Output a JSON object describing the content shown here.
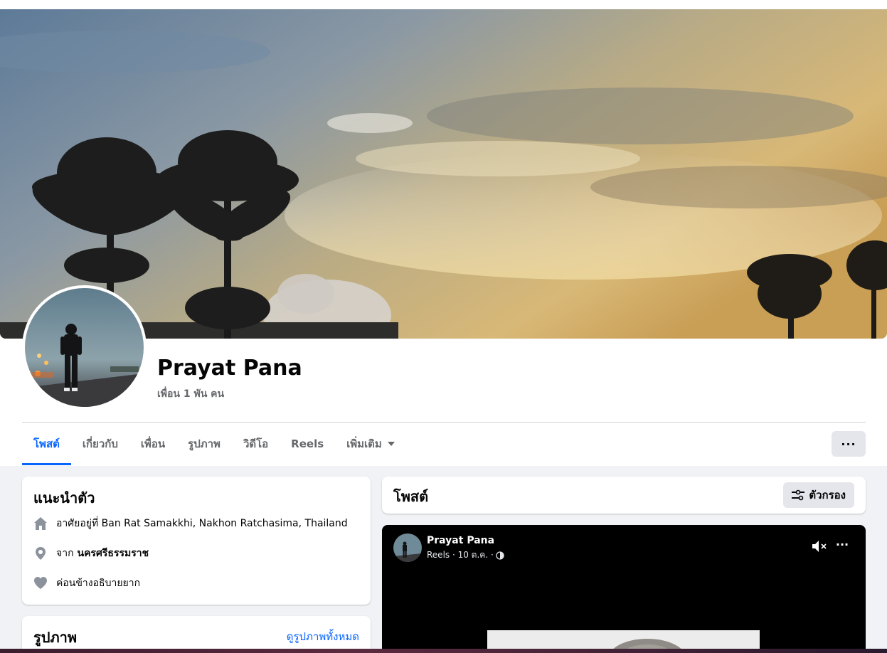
{
  "profile": {
    "name": "Prayat Pana",
    "friends": "เพื่อน 1 พัน คน"
  },
  "tabs": [
    {
      "label": "โพสต์",
      "active": true
    },
    {
      "label": "เกี่ยวกับ",
      "active": false
    },
    {
      "label": "เพื่อน",
      "active": false
    },
    {
      "label": "รูปภาพ",
      "active": false
    },
    {
      "label": "วิดีโอ",
      "active": false
    },
    {
      "label": "Reels",
      "active": false
    },
    {
      "label": "เพิ่มเติม",
      "active": false
    }
  ],
  "more_button": "···",
  "intro": {
    "title": "แนะนำตัว",
    "lives_in": "อาศัยอยู่ที่ Ban Rat Samakkhi, Nakhon Ratchasima, Thailand",
    "from_prefix": "จาก",
    "from_place": "นครศรีธรรมราช",
    "relationship": "ค่อนข้างอธิบายยาก"
  },
  "photos": {
    "title": "รูปภาพ",
    "see_all": "ดูรูปภาพทั้งหมด"
  },
  "posts": {
    "title": "โพสต์",
    "filter_label": "ตัวกรอง"
  },
  "post": {
    "author": "Prayat Pana",
    "meta": "Reels · 10 ต.ค. ·",
    "more": "···"
  },
  "icons": [
    "home-icon",
    "location-pin-icon",
    "heart-icon",
    "filter-icon",
    "globe-icon",
    "muted-speaker-icon",
    "more-icon",
    "chevron-down-icon"
  ],
  "colors": {
    "accent": "#0866ff",
    "secondary_text": "#65676b",
    "page_bg": "#f0f2f5",
    "button_bg": "#e4e6eb"
  }
}
